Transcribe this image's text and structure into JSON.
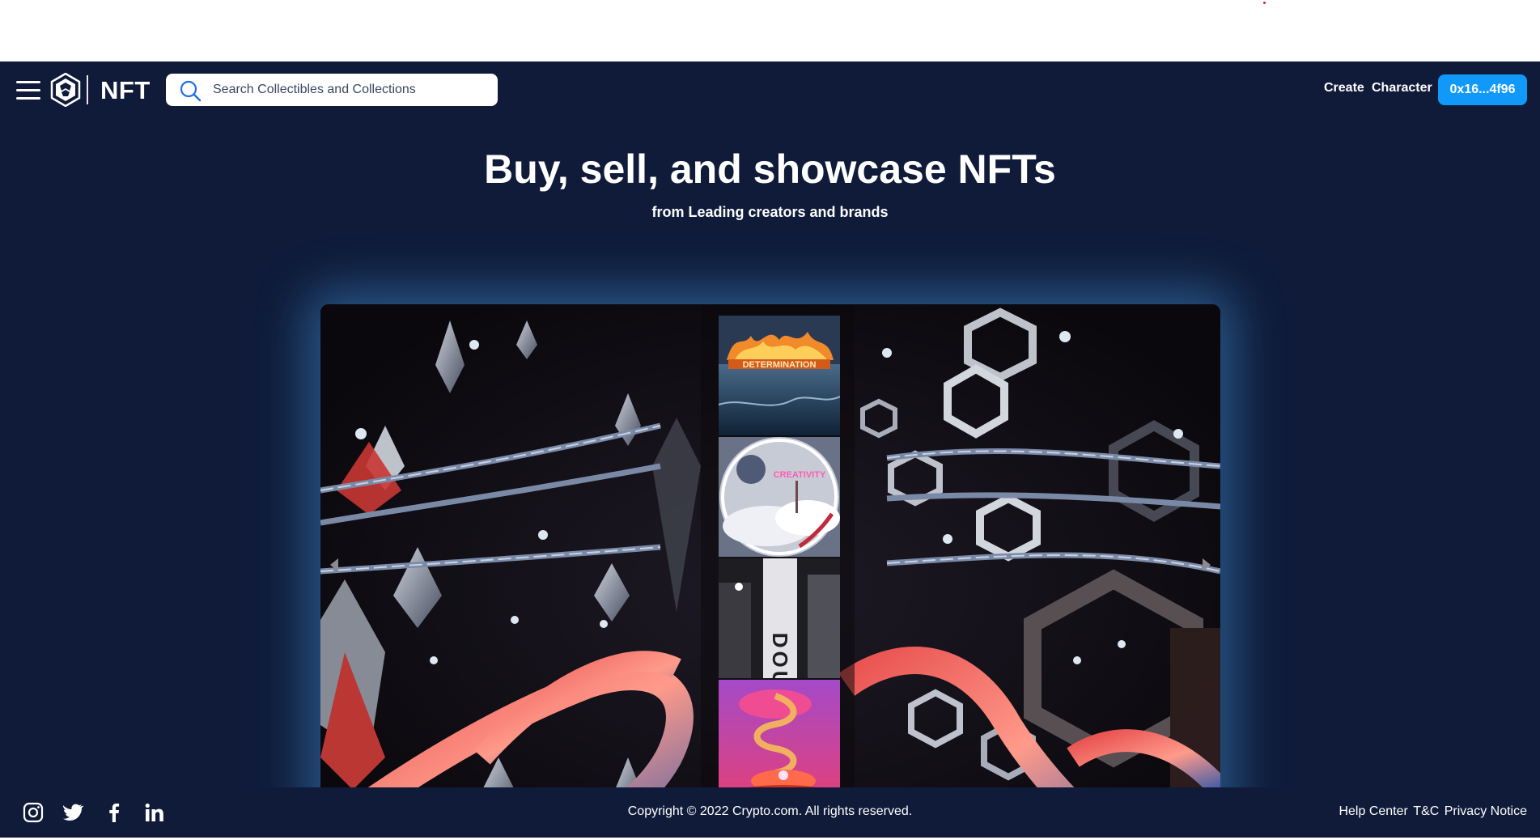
{
  "header": {
    "brand": "NFT",
    "search": {
      "placeholder": "Search Collectibles and Collections",
      "value": ""
    },
    "nav": {
      "create": "Create",
      "character": "Character"
    },
    "wallet": "0x16...4f96"
  },
  "hero": {
    "title": "Buy, sell, and showcase NFTs",
    "subtitle": "from Leading creators and brands"
  },
  "banner": {
    "thumbnails": [
      {
        "icon": "fire-ocean-artwork"
      },
      {
        "icon": "cloud-sign-artwork"
      },
      {
        "icon": "doubt-tower-artwork"
      },
      {
        "icon": "spiral-staircase-artwork"
      }
    ],
    "thumb_labels": [
      "DETERMINATION",
      "CREATIVITY",
      "DOUBT"
    ]
  },
  "footer": {
    "social": [
      "instagram-icon",
      "twitter-icon",
      "facebook-icon",
      "linkedin-icon"
    ],
    "copyright": "Copyright © 2022 Crypto.com. All rights reserved.",
    "links": {
      "help": "Help Center",
      "tc": "T&C",
      "privacy": "Privacy Notice"
    }
  },
  "colors": {
    "background": "#0f1b39",
    "accent": "#1199fa",
    "text": "#ffffff"
  }
}
